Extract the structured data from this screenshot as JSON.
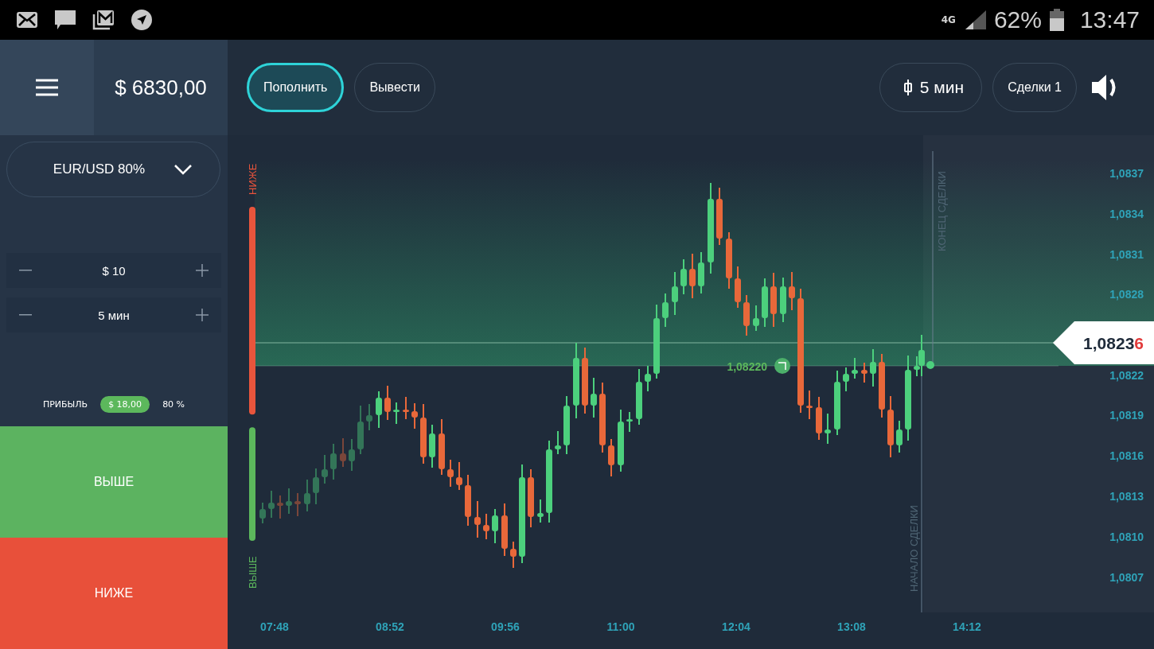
{
  "status_bar": {
    "network": "4G",
    "battery": "62%",
    "time": "13:47"
  },
  "account": {
    "balance": "$ 6830,00"
  },
  "header": {
    "buttons": [
      {
        "label": "Пополнить",
        "selected": true
      },
      {
        "label": "Вывести",
        "selected": false
      }
    ],
    "timeframe": "5 мин",
    "deals": "Сделки 1"
  },
  "asset": {
    "label": "EUR/USD 80%"
  },
  "steppers": [
    {
      "value": "$ 10"
    },
    {
      "value": "5 мин"
    }
  ],
  "profit": {
    "label": "ПРИБЫЛЬ",
    "amount": "$ 18,00",
    "percent": "80 %"
  },
  "actions": [
    {
      "label": "ВЫШЕ",
      "kind": "up"
    },
    {
      "label": "НИЖЕ",
      "kind": "down"
    }
  ],
  "sentiment": {
    "down_label": "НИЖЕ",
    "up_label": "ВЫШЕ",
    "level": 0.34
  },
  "chart": {
    "y_labels": [
      "1,0837",
      "1,0834",
      "1,0831",
      "1,0828",
      "1,0822",
      "1,0819",
      "1,0816",
      "1,0813",
      "1,0810",
      "1,0807"
    ],
    "x_labels": [
      "07:48",
      "08:52",
      "09:56",
      "11:00",
      "12:04",
      "13:08",
      "14:12"
    ],
    "current_price": "1,0823",
    "current_price_last": "6",
    "entry_price": "1,08220",
    "end_label": "КОНЕЦ СДЕЛКИ",
    "start_label": "НАЧАЛО СДЕЛКИ"
  }
}
